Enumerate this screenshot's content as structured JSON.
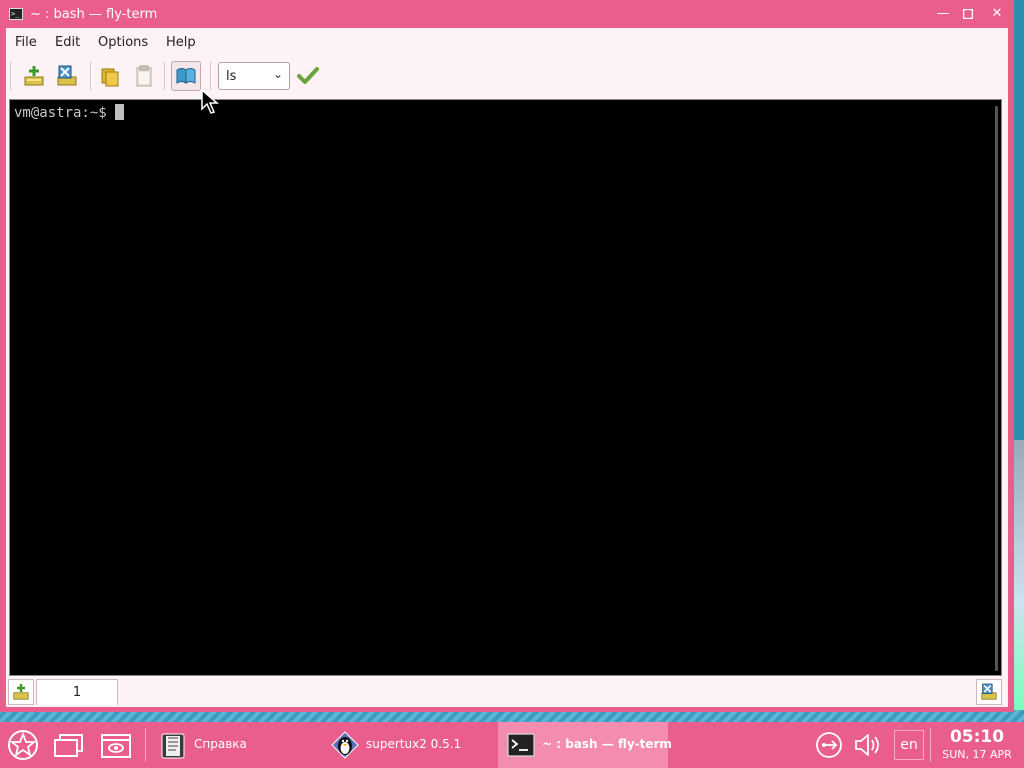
{
  "window": {
    "title": "~ : bash — fly-term",
    "title_icon": "terminal-icon",
    "controls": [
      "minimize",
      "maximize",
      "close"
    ],
    "accent_color": "#e95e8d"
  },
  "menubar": {
    "items": [
      {
        "label": "File"
      },
      {
        "label": "Edit"
      },
      {
        "label": "Options"
      },
      {
        "label": "Help"
      }
    ]
  },
  "toolbar": {
    "buttons": [
      {
        "icon": "new-tab-icon"
      },
      {
        "icon": "close-tab-icon"
      },
      {
        "icon": "copy-icon"
      },
      {
        "icon": "paste-icon"
      },
      {
        "icon": "book-icon",
        "active": true
      }
    ],
    "command_combo": {
      "value": "ls"
    },
    "run_icon": "checkmark-icon"
  },
  "terminal": {
    "prompt": "vm@astra:~$ ",
    "background": "#000000",
    "foreground": "#c8c8c8"
  },
  "tabbar": {
    "tabs": [
      {
        "label": "1"
      }
    ]
  },
  "taskbar": {
    "launchers": [
      "start-menu-icon",
      "windows-icon",
      "show-desktop-icon"
    ],
    "tasks": [
      {
        "label": "Справка",
        "icon": "help-book-icon",
        "active": false
      },
      {
        "label": "supertux2 0.5.1",
        "icon": "penguin-icon",
        "active": false
      },
      {
        "label": "~ : bash — fly-term",
        "icon": "terminal-icon",
        "active": true
      }
    ],
    "tray": {
      "network_icon": "network-icon",
      "volume_icon": "volume-icon",
      "language": "en",
      "time": "05:10",
      "date": "SUN, 17 APR"
    }
  }
}
